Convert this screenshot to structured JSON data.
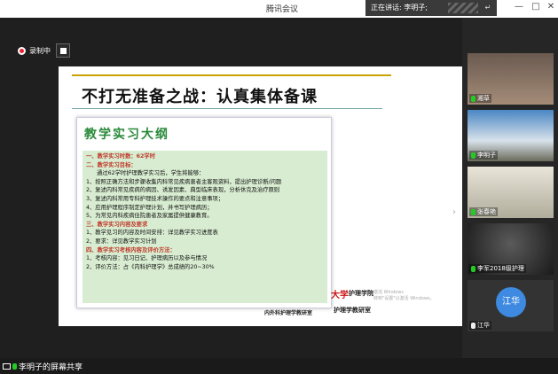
{
  "window": {
    "title": "腾讯会议",
    "speaking_label": "正在讲话: 李明子;",
    "controls": {
      "minimize": "—",
      "maximize": "□",
      "close": "✕"
    }
  },
  "recording": {
    "label": "录制中"
  },
  "slide": {
    "title": "不打无准备之战：认真集体备课",
    "card_title": "教学实习大纲",
    "lines": [
      {
        "text": "一、教学实习时数：62学时",
        "style": "red"
      },
      {
        "text": "二、教学实习目标：",
        "style": "red"
      },
      {
        "text": "通过62学时护理教学实习后，学生将能够：",
        "style": "indent"
      },
      {
        "text": "1、按照正确方法和步骤收集内科常见疾病患者主客观资料，提出护理诊断/问题",
        "style": ""
      },
      {
        "text": "2、复述内科常见疾病的病因、诱发因素、典型临床表现，分析休克及治疗原则",
        "style": ""
      },
      {
        "text": "3、复述内科常用专科护理技术操作的要点和注意事项；",
        "style": ""
      },
      {
        "text": "4、应用护理程序制定护理计划，并书写护理病历；",
        "style": ""
      },
      {
        "text": "5、为常见内科疾病住院患者及家属提供健康教育。",
        "style": ""
      },
      {
        "text": "三、教学实习内容及要求",
        "style": "red"
      },
      {
        "text": "1、教学见习的内容及时间安排：详见教学实习进度表",
        "style": ""
      },
      {
        "text": "2、要求：详见教学实习计划",
        "style": ""
      },
      {
        "text": "四、教学实习考核内容及评价方法：",
        "style": "red"
      },
      {
        "text": "1、考核内容：见习日记、护理病历以及参与情况",
        "style": ""
      },
      {
        "text": "2、评价方法：占《内科护理学》总成绩的20~30%",
        "style": ""
      }
    ],
    "logo_text": "护理学院",
    "watermark_line1": "激活 Windows",
    "watermark_line2": "转到\"设置\"以激活 Windows。",
    "footer_left": "内外科护理学教研室",
    "footer_right": "护理学教研室"
  },
  "participants": [
    {
      "name": "湘草",
      "mic": "on"
    },
    {
      "name": "李明子",
      "mic": "on"
    },
    {
      "name": "张春艳",
      "mic": "on"
    },
    {
      "name": "李军2018级护理",
      "mic": "on"
    },
    {
      "name": "江华",
      "mic": "off",
      "avatar_text": "江华"
    }
  ],
  "share": {
    "label": "李明子的屏幕共享"
  },
  "colors": {
    "accent_green": "#2a8a3a",
    "heading_red": "#c0392b",
    "card_bg": "#d7ecd0",
    "record_red": "#e23"
  }
}
